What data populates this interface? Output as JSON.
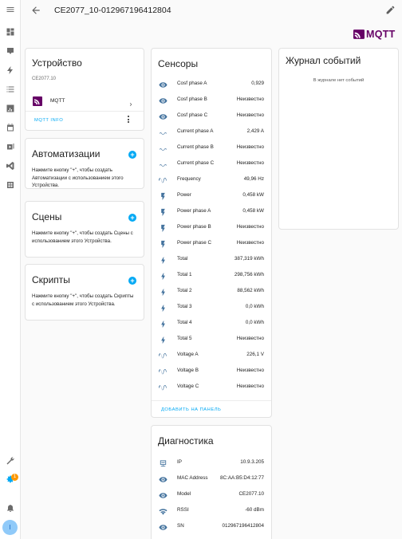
{
  "header": {
    "title": "CE2077_10-012967196412804"
  },
  "brand": {
    "logo_text": "MQTT",
    "color": "#660066"
  },
  "device_card": {
    "title": "Устройство",
    "model": "CE2077.10",
    "integration_label": "MQTT",
    "info_button": "MQTT INFO"
  },
  "automations": {
    "title": "Автоматизации",
    "description": "Нажмите кнопку \"+\", чтобы создать Автоматизации с использованием этого Устройства."
  },
  "scenes": {
    "title": "Сцены",
    "description": "Нажмите кнопку \"+\", чтобы создать Сцены с использованием этого Устройства."
  },
  "scripts": {
    "title": "Скрипты",
    "description": "Нажмите кнопку \"+\", чтобы создать Скрипты с использованием этого Устройства."
  },
  "sensors": {
    "title": "Сенсоры",
    "add_to_panel": "ДОБАВИТЬ НА ПАНЕЛЬ",
    "items": [
      {
        "icon": "eye-icon",
        "name": "Cosf phase A",
        "value": "0,929"
      },
      {
        "icon": "eye-icon",
        "name": "Cosf phase B",
        "value": "Неизвестно"
      },
      {
        "icon": "eye-icon",
        "name": "Cosf phase C",
        "value": "Неизвестно"
      },
      {
        "icon": "current-ac-icon",
        "name": "Current phase A",
        "value": "2,429 A"
      },
      {
        "icon": "current-ac-icon",
        "name": "Current phase B",
        "value": "Неизвестно"
      },
      {
        "icon": "current-ac-icon",
        "name": "Current phase C",
        "value": "Неизвестно"
      },
      {
        "icon": "sine-wave-icon",
        "name": "Frequency",
        "value": "49,96 Hz"
      },
      {
        "icon": "flash-icon",
        "name": "Power",
        "value": "0,458 kW"
      },
      {
        "icon": "flash-icon",
        "name": "Power phase A",
        "value": "0,458 kW"
      },
      {
        "icon": "flash-icon",
        "name": "Power phase B",
        "value": "Неизвестно"
      },
      {
        "icon": "flash-icon",
        "name": "Power phase C",
        "value": "Неизвестно"
      },
      {
        "icon": "lightning-icon",
        "name": "Total",
        "value": "387,319 kWh"
      },
      {
        "icon": "lightning-icon",
        "name": "Total 1",
        "value": "298,756 kWh"
      },
      {
        "icon": "lightning-icon",
        "name": "Total 2",
        "value": "88,562 kWh"
      },
      {
        "icon": "lightning-icon",
        "name": "Total 3",
        "value": "0,0 kWh"
      },
      {
        "icon": "lightning-icon",
        "name": "Total 4",
        "value": "0,0 kWh"
      },
      {
        "icon": "lightning-icon",
        "name": "Total 5",
        "value": "Неизвестно"
      },
      {
        "icon": "sine-wave-icon",
        "name": "Voltage A",
        "value": "226,1 V"
      },
      {
        "icon": "sine-wave-icon",
        "name": "Voltage B",
        "value": "Неизвестно"
      },
      {
        "icon": "sine-wave-icon",
        "name": "Voltage C",
        "value": "Неизвестно"
      }
    ]
  },
  "diagnostics": {
    "title": "Диагностика",
    "items": [
      {
        "icon": "ip-network-icon",
        "name": "IP",
        "value": "10.9.3.205"
      },
      {
        "icon": "eye-icon",
        "name": "MAC Address",
        "value": "8C:AA:B5:D4:12:77"
      },
      {
        "icon": "eye-icon",
        "name": "Model",
        "value": "CE2077.10"
      },
      {
        "icon": "wifi-icon",
        "name": "RSSI",
        "value": "-60 dBm"
      },
      {
        "icon": "eye-icon",
        "name": "SN",
        "value": "012967196412804"
      }
    ]
  },
  "logbook": {
    "title": "Журнал событий",
    "empty_text": "В журнале нет событий"
  },
  "sidebar": {
    "notification_count": "1",
    "user_initial": "I"
  },
  "colors": {
    "accent": "#03a9f4",
    "icon": "#44739e"
  }
}
